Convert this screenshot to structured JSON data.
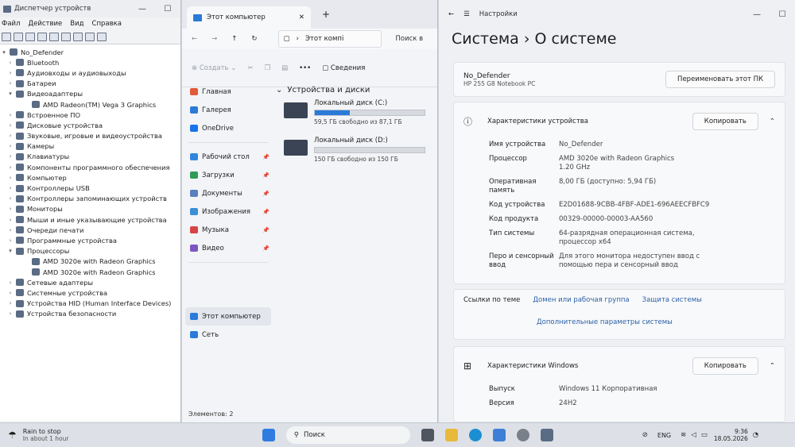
{
  "devmgr": {
    "title": "Диспетчер устройств",
    "menu": [
      "Файл",
      "Действие",
      "Вид",
      "Справка"
    ],
    "tree": [
      {
        "label": "No_Defender",
        "level": 0,
        "arrow": "▾"
      },
      {
        "label": "Bluetooth",
        "level": 1,
        "arrow": "›"
      },
      {
        "label": "Аудиовходы и аудиовыходы",
        "level": 1,
        "arrow": "›"
      },
      {
        "label": "Батареи",
        "level": 1,
        "arrow": "›"
      },
      {
        "label": "Видеоадаптеры",
        "level": 1,
        "arrow": "▾"
      },
      {
        "label": "AMD Radeon(TM) Vega 3 Graphics",
        "level": 2,
        "arrow": ""
      },
      {
        "label": "Встроенное ПО",
        "level": 1,
        "arrow": "›"
      },
      {
        "label": "Дисковые устройства",
        "level": 1,
        "arrow": "›"
      },
      {
        "label": "Звуковые, игровые и видеоустройства",
        "level": 1,
        "arrow": "›"
      },
      {
        "label": "Камеры",
        "level": 1,
        "arrow": "›"
      },
      {
        "label": "Клавиатуры",
        "level": 1,
        "arrow": "›"
      },
      {
        "label": "Компоненты программного обеспечения",
        "level": 1,
        "arrow": "›"
      },
      {
        "label": "Компьютер",
        "level": 1,
        "arrow": "›"
      },
      {
        "label": "Контроллеры USB",
        "level": 1,
        "arrow": "›"
      },
      {
        "label": "Контроллеры запоминающих устройств",
        "level": 1,
        "arrow": "›"
      },
      {
        "label": "Мониторы",
        "level": 1,
        "arrow": "›"
      },
      {
        "label": "Мыши и иные указывающие устройства",
        "level": 1,
        "arrow": "›"
      },
      {
        "label": "Очереди печати",
        "level": 1,
        "arrow": "›"
      },
      {
        "label": "Программные устройства",
        "level": 1,
        "arrow": "›"
      },
      {
        "label": "Процессоры",
        "level": 1,
        "arrow": "▾"
      },
      {
        "label": "AMD 3020e with Radeon Graphics",
        "level": 2,
        "arrow": ""
      },
      {
        "label": "AMD 3020e with Radeon Graphics",
        "level": 2,
        "arrow": ""
      },
      {
        "label": "Сетевые адаптеры",
        "level": 1,
        "arrow": "›"
      },
      {
        "label": "Системные устройства",
        "level": 1,
        "arrow": "›"
      },
      {
        "label": "Устройства HID (Human Interface Devices)",
        "level": 1,
        "arrow": "›"
      },
      {
        "label": "Устройства безопасности",
        "level": 1,
        "arrow": "›"
      }
    ]
  },
  "explorer": {
    "tab_title": "Этот компьютер",
    "address": "Этот компі",
    "search": "Поиск в",
    "create": "Создать",
    "details": "Сведения",
    "sidebar": [
      {
        "label": "Главная",
        "pin": false,
        "color": "#e15b3a"
      },
      {
        "label": "Галерея",
        "pin": false,
        "color": "#2c7ad6"
      },
      {
        "label": "OneDrive",
        "pin": false,
        "color": "#1a73e8"
      },
      {
        "label": "Рабочий стол",
        "pin": true,
        "color": "#2f86dd"
      },
      {
        "label": "Загрузки",
        "pin": true,
        "color": "#2f9b56"
      },
      {
        "label": "Документы",
        "pin": true,
        "color": "#5a7fbf"
      },
      {
        "label": "Изображения",
        "pin": true,
        "color": "#3b8fd4"
      },
      {
        "label": "Музыка",
        "pin": true,
        "color": "#d64545"
      },
      {
        "label": "Видео",
        "pin": true,
        "color": "#7a56c4"
      },
      {
        "label": "Этот компьютер",
        "pin": false,
        "color": "#2a7bd9"
      },
      {
        "label": "Сеть",
        "pin": false,
        "color": "#2a7bd9"
      }
    ],
    "section": "Устройства и диски",
    "drives": [
      {
        "name": "Локальный диск (C:)",
        "free": "59,5 ГБ свободно из 87,1 ГБ",
        "used_fraction": 0.317
      },
      {
        "name": "Локальный диск (D:)",
        "free": "150 ГБ свободно из 150 ГБ",
        "used_fraction": 0.0
      }
    ],
    "status": "Элементов: 2"
  },
  "settings": {
    "title": "Настройки",
    "heading": "Система  ›  О системе",
    "device_name": "No_Defender",
    "model": "HP 255 G8 Notebook PC",
    "rename_btn": "Переименовать этот ПК",
    "device_specs_title": "Характеристики устройства",
    "copy_btn": "Копировать",
    "specs": [
      {
        "k": "Имя устройства",
        "v": "No_Defender"
      },
      {
        "k": "Процессор",
        "v": "AMD 3020e with Radeon Graphics\n1.20 GHz"
      },
      {
        "k": "Оперативная память",
        "v": "8,00 ГБ (доступно: 5,94 ГБ)"
      },
      {
        "k": "Код устройства",
        "v": "E2D01688-9CBB-4FBF-ADE1-696AEECFBFC9"
      },
      {
        "k": "Код продукта",
        "v": "00329-00000-00003-AA560"
      },
      {
        "k": "Тип системы",
        "v": "64-разрядная операционная система,\nпроцессор x64"
      },
      {
        "k": "Перо и сенсорный ввод",
        "v": "Для этого монитора недоступен ввод с\nпомощью пера и сенсорный ввод"
      }
    ],
    "links_label": "Ссылки по теме",
    "links": [
      "Домен или рабочая группа",
      "Защита системы"
    ],
    "adv_link": "Дополнительные параметры системы",
    "win_specs_title": "Характеристики Windows",
    "win_specs": [
      {
        "k": "Выпуск",
        "v": "Windows 11 Корпоративная"
      },
      {
        "k": "Версия",
        "v": "24H2"
      }
    ]
  },
  "taskbar": {
    "weather_title": "Rain to stop",
    "weather_sub": "In about 1 hour",
    "search": "Поиск",
    "lang": "ENG",
    "time": "9:36",
    "date": "18.05.2026"
  }
}
